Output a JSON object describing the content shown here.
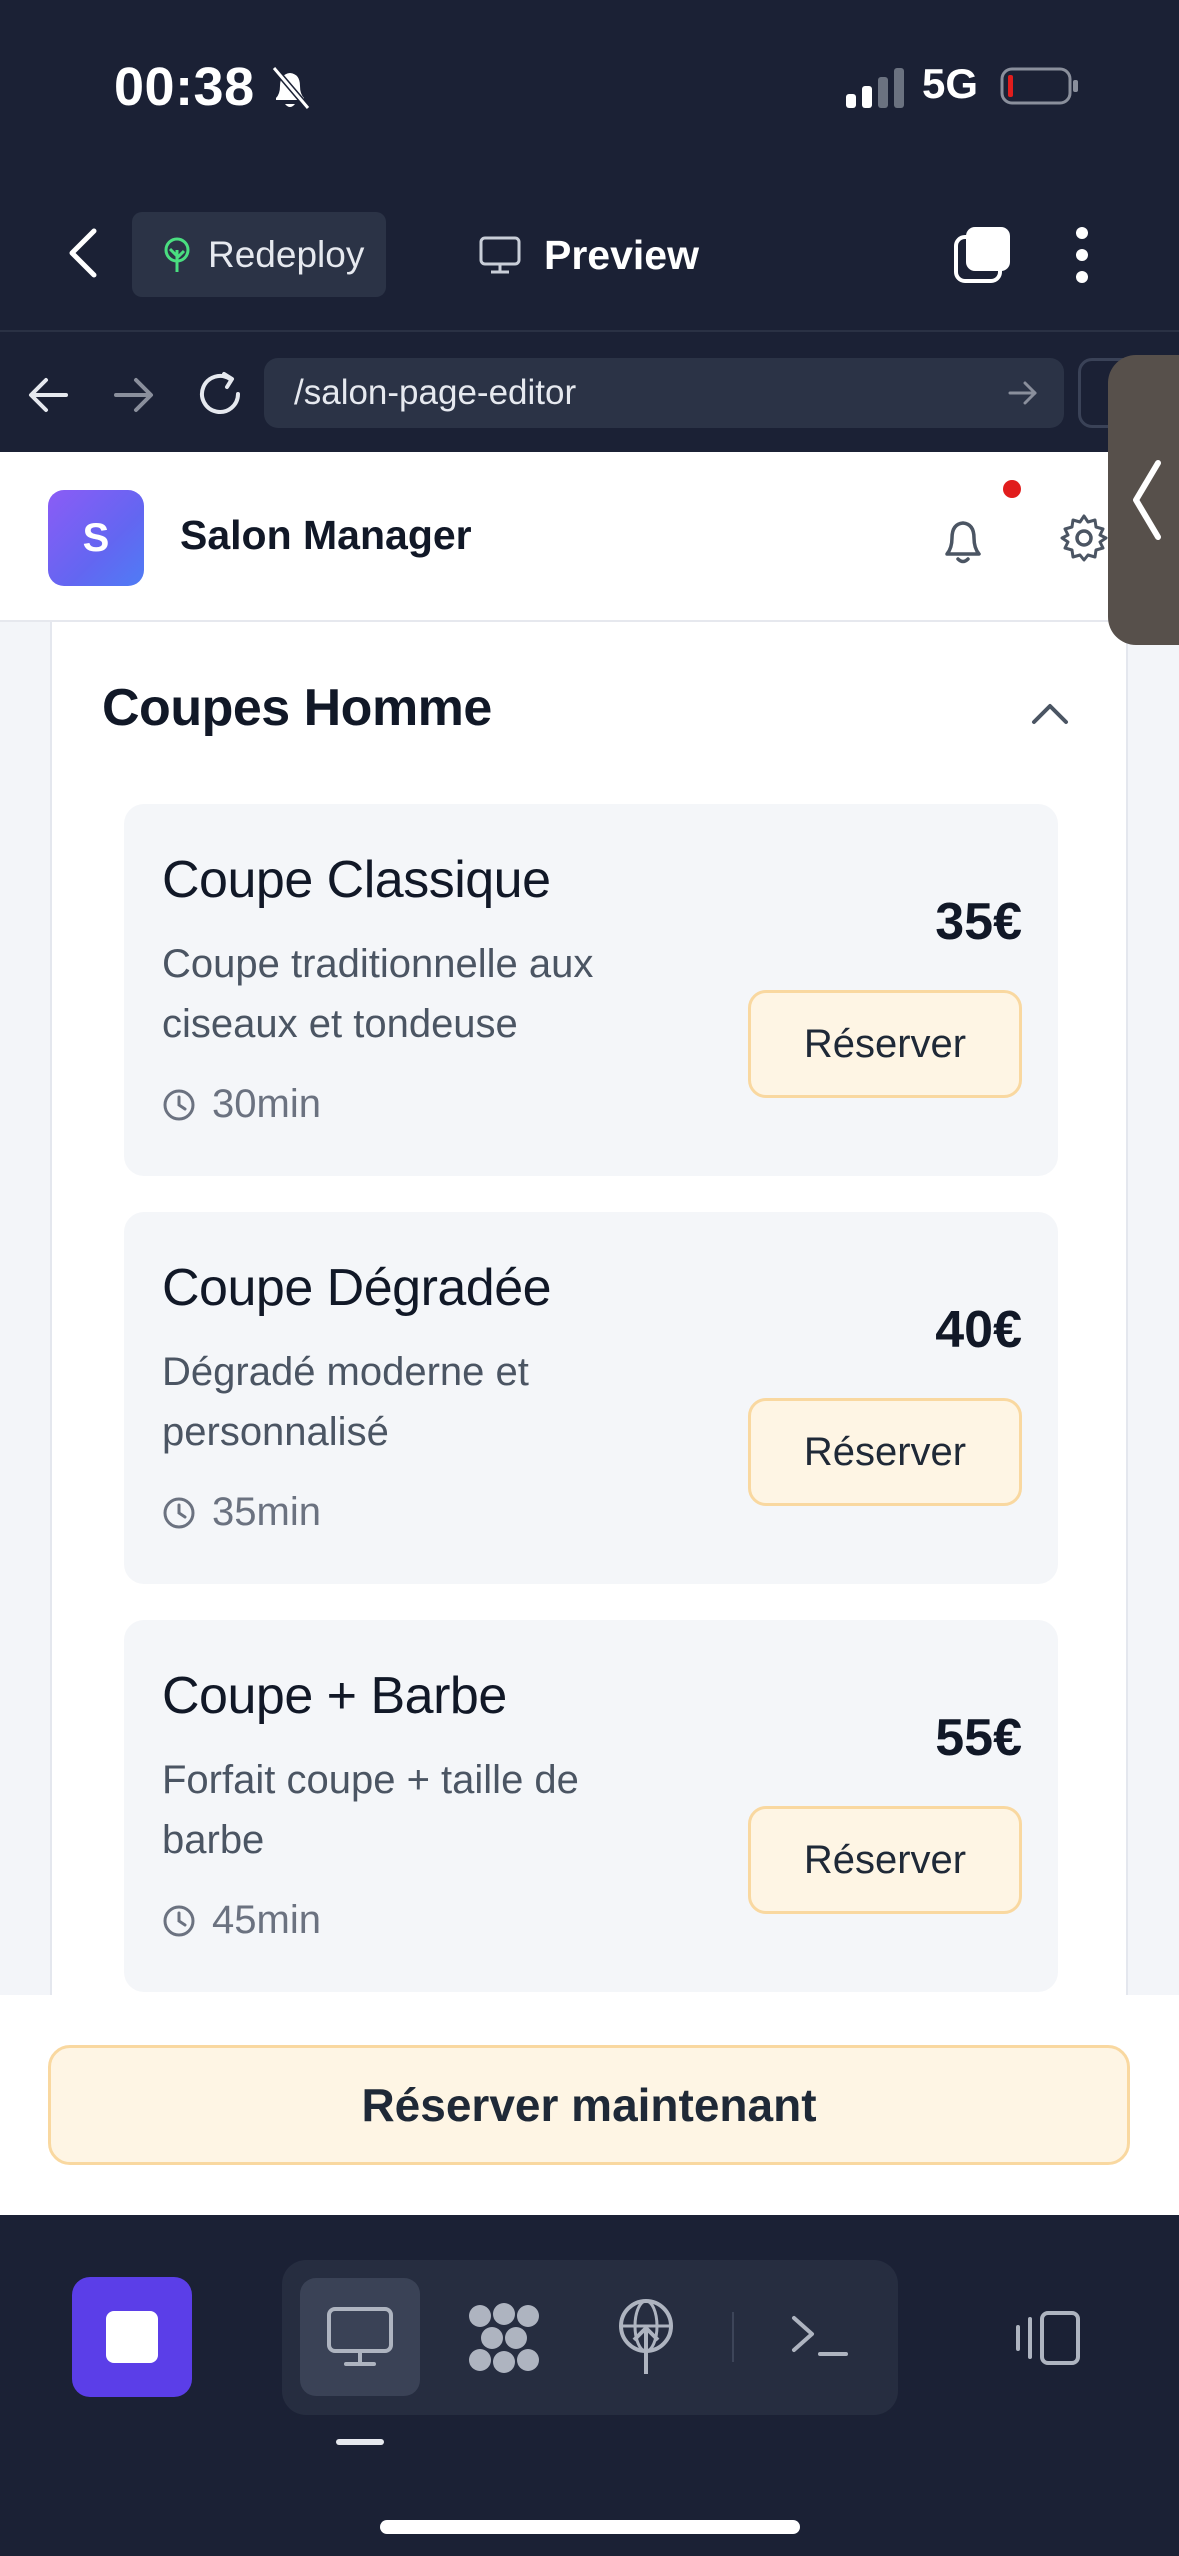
{
  "status_bar": {
    "time": "00:38",
    "network": "5G"
  },
  "toolbar": {
    "redeploy_label": "Redeploy",
    "preview_label": "Preview"
  },
  "browser": {
    "url": "/salon-page-editor"
  },
  "site": {
    "logo_letter": "S",
    "name": "Salon Manager"
  },
  "section": {
    "title": "Coupes Homme",
    "services": [
      {
        "name": "Coupe Classique",
        "description": "Coupe traditionnelle aux ciseaux et tondeuse",
        "duration": "30min",
        "price": "35€",
        "button": "Réserver"
      },
      {
        "name": "Coupe Dégradée",
        "description": "Dégradé moderne et personnalisé",
        "duration": "35min",
        "price": "40€",
        "button": "Réserver"
      },
      {
        "name": "Coupe + Barbe",
        "description": "Forfait coupe + taille de barbe",
        "duration": "45min",
        "price": "55€",
        "button": "Réserver"
      }
    ]
  },
  "cta": {
    "label": "Réserver maintenant"
  },
  "colors": {
    "accent": "#5b3ee8",
    "button_bg": "#fef5e4",
    "button_border": "#f9d8a0",
    "chrome_bg": "#1b2135",
    "notification_dot": "#e11d1d"
  },
  "icons": [
    "bell-off-icon",
    "signal-icon",
    "battery-icon",
    "chevron-left-icon",
    "tree-icon",
    "monitor-icon",
    "tabs-icon",
    "more-vertical-icon",
    "arrow-left-icon",
    "arrow-right-icon",
    "reload-icon",
    "bell-icon",
    "gear-icon",
    "chevron-up-icon",
    "clock-icon",
    "stop-icon",
    "cluster-icon",
    "globe-deploy-icon",
    "terminal-icon",
    "side-panel-icon"
  ]
}
